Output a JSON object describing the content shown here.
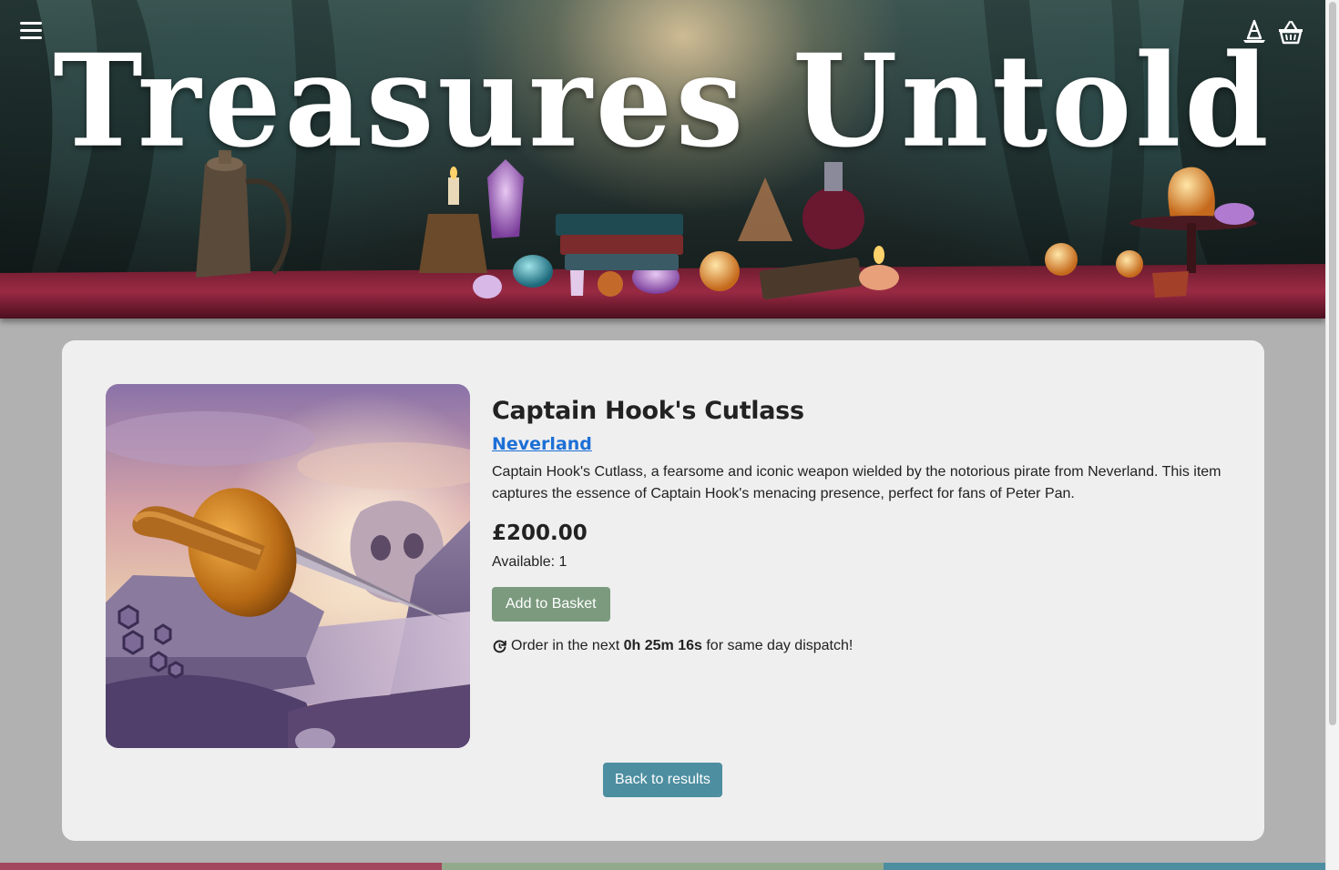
{
  "header": {
    "site_title": "Treasures Untold",
    "menu_icon": "hamburger-menu-icon",
    "wizard_icon": "wizard-hat-icon",
    "basket_icon": "basket-icon"
  },
  "product": {
    "title": "Captain Hook's Cutlass",
    "realm": "Neverland",
    "description": "Captain Hook's Cutlass, a fearsome and iconic weapon wielded by the notorious pirate from Neverland. This item captures the essence of Captain Hook's menacing presence, perfect for fans of Peter Pan.",
    "price": "£200.00",
    "available_label": "Available:",
    "available_count": "1",
    "add_to_basket": "Add to Basket",
    "dispatch": {
      "icon": "clock-refresh-icon",
      "prefix": "Order in the next",
      "time": "0h 25m 16s",
      "suffix": "for same day dispatch!"
    },
    "back_label": "Back to results"
  },
  "colors": {
    "page_bg": "#b1b1b1",
    "card_bg": "#efefef",
    "add_button": "#7b9a7e",
    "back_button": "#4d8ea1",
    "link": "#1d6fd6",
    "footer_bands": [
      "#a3475e",
      "#93a98c",
      "#4d8ea1"
    ]
  }
}
